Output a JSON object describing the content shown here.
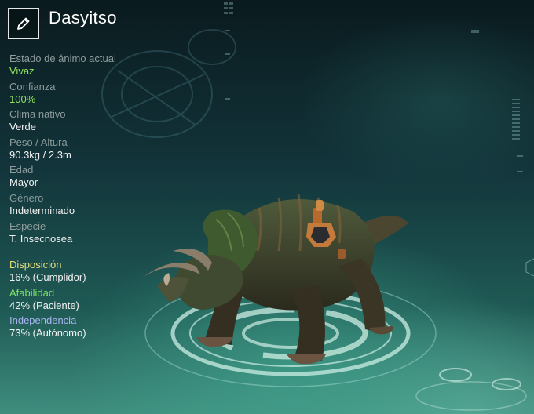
{
  "header": {
    "title": "Dasyitso",
    "edit_icon": "pencil-icon"
  },
  "stats": [
    {
      "label": "Estado de ánimo actual",
      "value": "Vivaz",
      "highlight": true
    },
    {
      "label": "Confianza",
      "value": "100%",
      "highlight": true
    },
    {
      "label": "Clima nativo",
      "value": "Verde",
      "highlight": false
    },
    {
      "label": "Peso / Altura",
      "value": "90.3kg / 2.3m",
      "highlight": false
    },
    {
      "label": "Edad",
      "value": "Mayor",
      "highlight": false
    },
    {
      "label": "Género",
      "value": "Indeterminado",
      "highlight": false
    },
    {
      "label": "Especie",
      "value": "T. Insecnosea",
      "highlight": false
    }
  ],
  "traits": [
    {
      "label": "Disposición",
      "value": "16% (Cumplidor)",
      "color": "#e6e07c"
    },
    {
      "label": "Afabilidad",
      "value": "42% (Paciente)",
      "color": "#7ee06a"
    },
    {
      "label": "Independencia",
      "value": "73% (Autónomo)",
      "color": "#a8b4f0"
    }
  ],
  "colors": {
    "highlight_value": "#8fe25e",
    "label_gray": "#8e9c9c"
  }
}
